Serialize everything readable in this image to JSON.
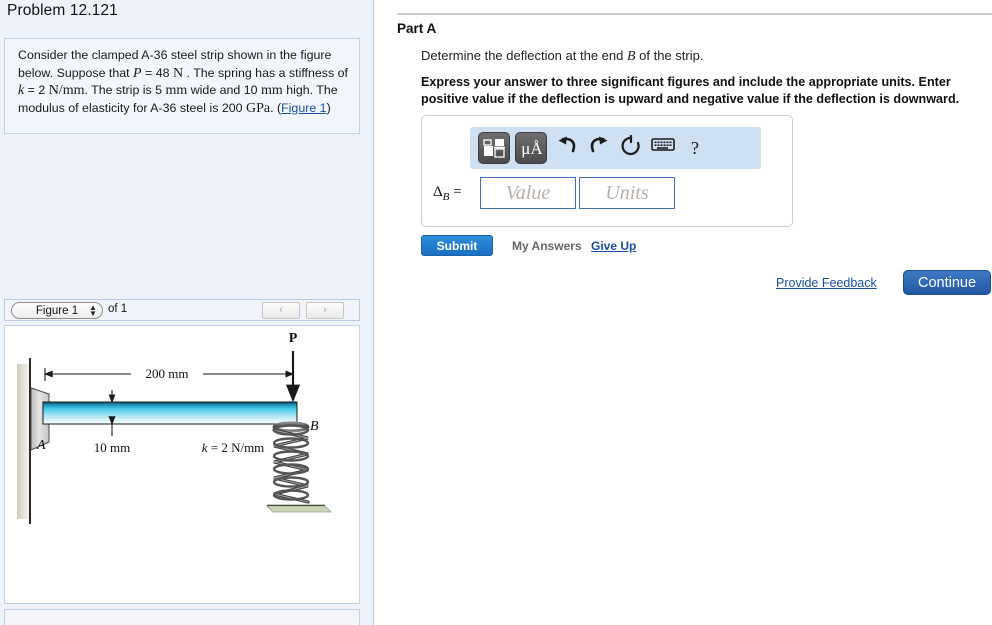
{
  "problem": {
    "title": "Problem 12.121",
    "statement_parts": [
      "Consider the clamped A-36 steel strip shown in the figure below. Suppose that ",
      "P",
      " = 48 ",
      "N",
      " . The spring has a stiffness of ",
      "k",
      " = 2 ",
      "N/mm",
      ". The strip is 5 ",
      "mm",
      " wide and 10 ",
      "mm",
      " high. The modulus of elasticity for A-36 steel is 200 ",
      "GPa",
      ". (",
      "Figure 1",
      ")"
    ],
    "figure_link_label": "Figure 1"
  },
  "figure_panel": {
    "select_value": "Figure 1",
    "of_label": "of 1",
    "prev_label": "‹",
    "next_label": "›"
  },
  "figure": {
    "force_label": "P",
    "length_label": "200 mm",
    "height_label": "10 mm",
    "spring_label": "k = 2 N/mm",
    "point_a": "A",
    "point_b": "B"
  },
  "part": {
    "title": "Part A",
    "question": "Determine the deflection at the end B of the strip.",
    "question_math_symbol": "B",
    "instruction": "Express your answer to three significant figures and include the appropriate units. Enter positive value if the deflection is upward and negative value if the deflection is downward."
  },
  "answer": {
    "label_symbol": "Δ",
    "label_subscript": "B",
    "label_equals": "=",
    "value_placeholder": "Value",
    "units_placeholder": "Units",
    "value_current": "",
    "units_current": ""
  },
  "toolbar": {
    "template_icon": "template-icon",
    "units_icon": "μÅ",
    "undo_icon": "↶",
    "redo_icon": "↷",
    "reset_icon": "↺",
    "keyboard_icon": "keyboard-icon",
    "help_icon": "?"
  },
  "actions": {
    "submit_label": "Submit",
    "my_answers_label": "My Answers",
    "give_up_label": "Give Up",
    "provide_feedback_label": "Provide Feedback",
    "continue_label": "Continue"
  },
  "colors": {
    "panel_bg": "#eef3fb",
    "accent_blue": "#1a4fa0",
    "submit_blue": "#1a6fc0",
    "continue_blue": "#2257a3",
    "toolbar_blue": "#cfe0f2",
    "beam_cyan": "#35c3e8"
  }
}
